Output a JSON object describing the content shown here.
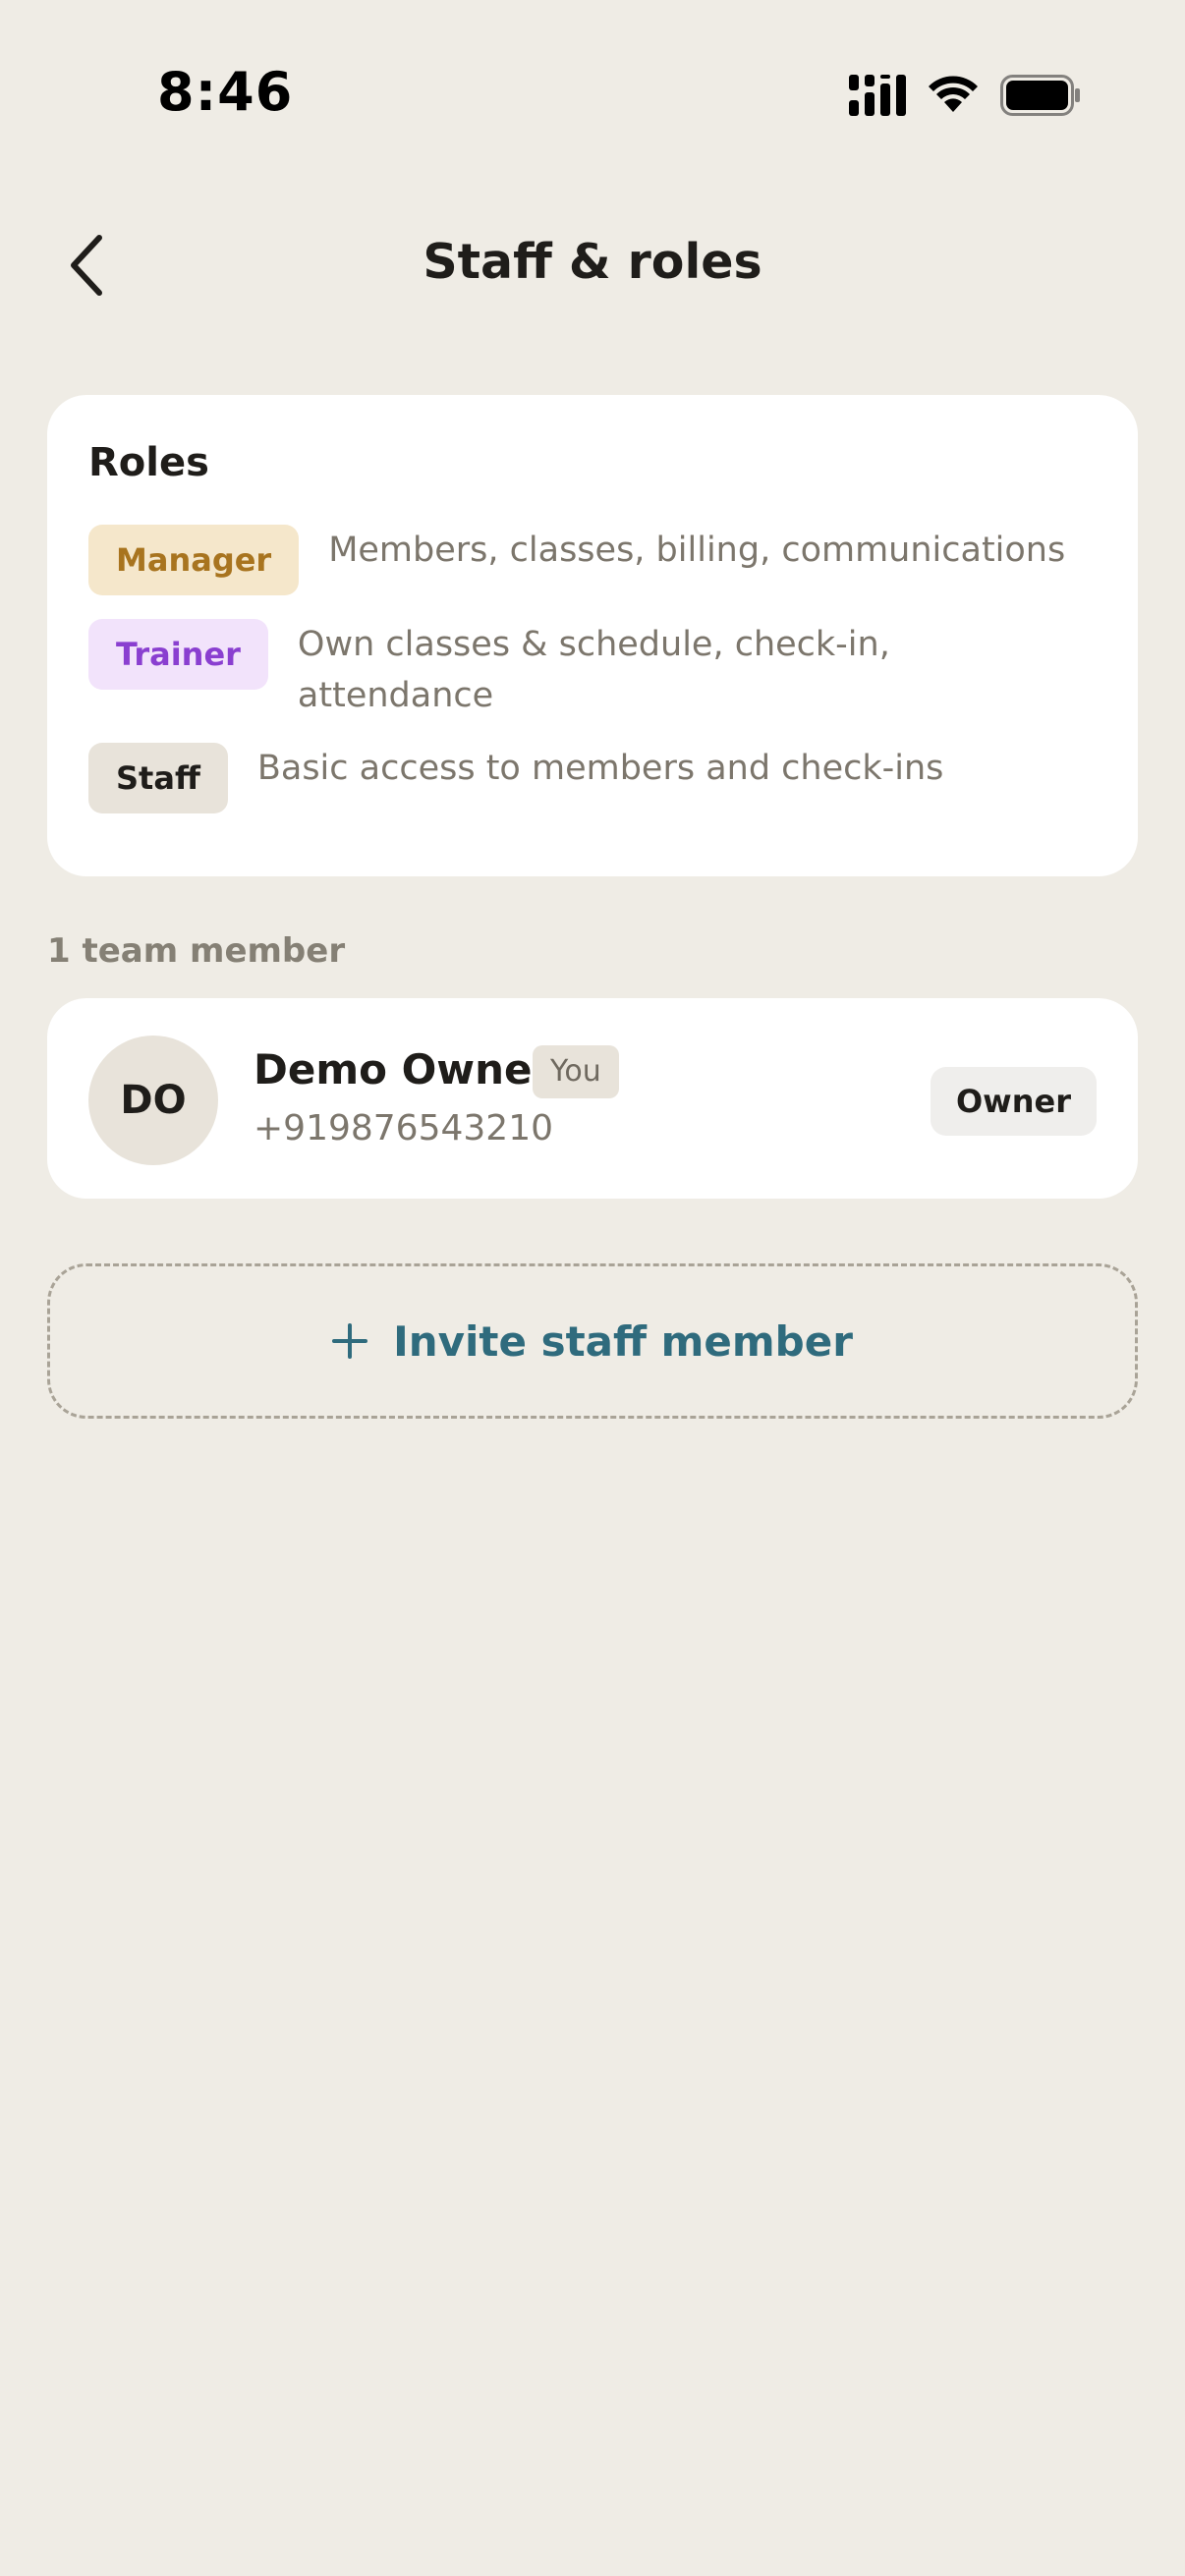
{
  "status_bar": {
    "time": "8:46"
  },
  "header": {
    "title": "Staff & roles"
  },
  "roles": {
    "heading": "Roles",
    "items": [
      {
        "name": "Manager",
        "description": "Members, classes, billing, communications",
        "color": "#a8741f",
        "bg": "#f5e7cb"
      },
      {
        "name": "Trainer",
        "description": "Own classes & schedule, check-in, attendance",
        "color": "#8a3fd0",
        "bg": "#f2e3fb"
      },
      {
        "name": "Staff",
        "description": "Basic access to members and check-ins",
        "color": "#1f1d1a",
        "bg": "#e8e3da"
      }
    ]
  },
  "team": {
    "count_label": "1 team member",
    "members": [
      {
        "initials": "DO",
        "name": "Demo Owner",
        "tag": "You",
        "phone": "+919876543210",
        "role": "Owner"
      }
    ]
  },
  "invite": {
    "label": "Invite staff member",
    "icon": "plus-icon"
  },
  "colors": {
    "background": "#efece5",
    "card": "#ffffff",
    "accent": "#2f6b7d"
  }
}
